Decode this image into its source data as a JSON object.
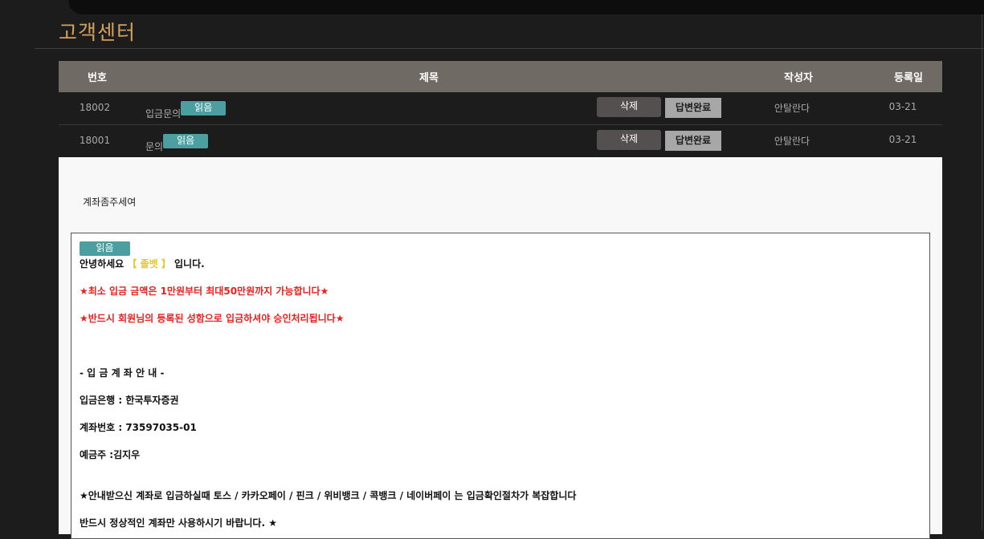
{
  "page": {
    "title": "고객센터"
  },
  "table": {
    "headers": {
      "num": "번호",
      "title": "제목",
      "writer": "작성자",
      "date": "등록일"
    },
    "rows": [
      {
        "num": "18002",
        "subject": "입금문의",
        "badge": "읽음",
        "delete_label": "삭제",
        "status_label": "답변완료",
        "writer": "안탈란다",
        "date": "03-21"
      },
      {
        "num": "18001",
        "subject": "문의",
        "badge": "읽음",
        "delete_label": "삭제",
        "status_label": "답변완료",
        "writer": "안탈란다",
        "date": "03-21"
      }
    ]
  },
  "detail": {
    "question": "계좌좀주세여",
    "answer": {
      "badge": "읽음",
      "greeting_prefix": "안녕하세요 ",
      "greeting_brand": "【 졸벳 】",
      "greeting_suffix": " 입니다.",
      "lines": [
        "★최소 입금 금액은 1만원부터 최대50만원까지 가능합니다★",
        "★반드시 회원님의 등록된 성함으로 입금하셔야 승인처리됩니다★",
        "- 입 금 계 좌 안 내 -",
        "입금은행 : 한국투자증권",
        "계좌번호 : 73597035-01",
        "예금주 :김지우",
        "★안내받으신 계좌로 입금하실때 토스 / 카카오페이 / 핀크 / 위비뱅크 / 콕뱅크 / 네이버페이 는 입금확인절차가 복잡합니다",
        "반드시 정상적인 계좌만 사용하시기 바랍니다. ★"
      ]
    }
  },
  "colors": {
    "accent": "#d2a05a",
    "badge": "#4b9fa1",
    "warning": "#e8201f",
    "brand": "#e8c52a"
  }
}
